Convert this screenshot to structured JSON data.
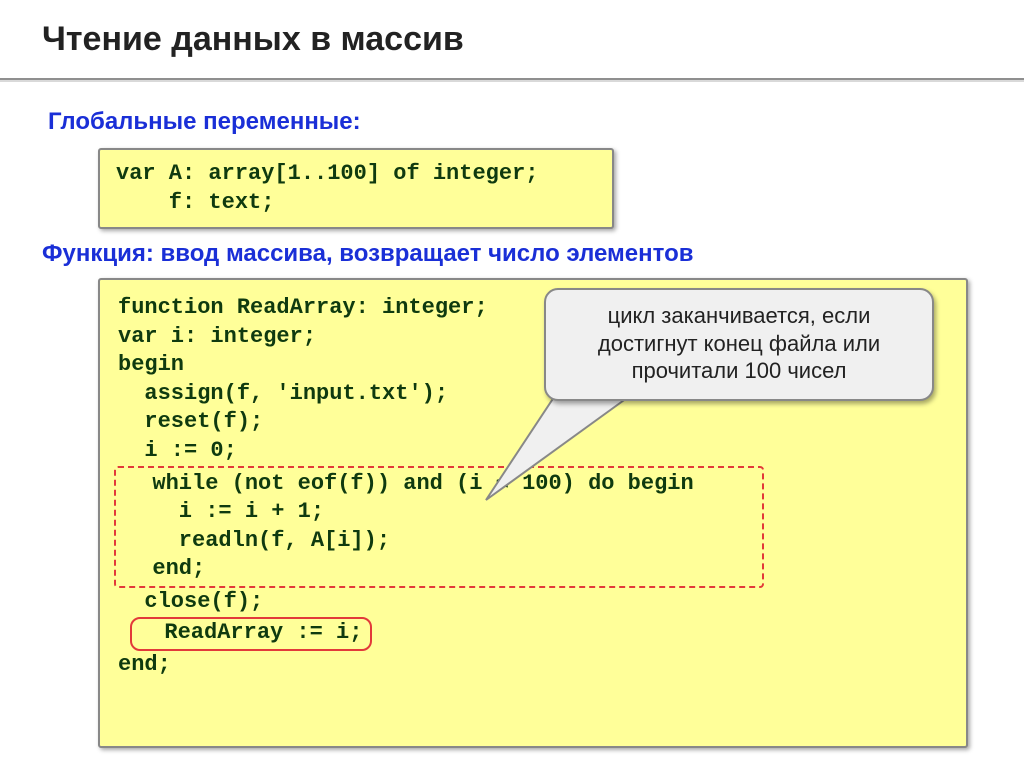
{
  "title": "Чтение данных в массив",
  "section1": "Глобальные переменные:",
  "globals_line1": "var A: array[1..100] of integer;",
  "globals_line2": "    f: text;",
  "section2": "Функция: ввод массива, возвращает число элементов",
  "callout": "цикл заканчивается, если достигнут конец файла или прочитали 100 чисел",
  "code": {
    "l1": "function ReadArray: integer;",
    "l2": "var i: integer;",
    "l3": "begin",
    "l4": "  assign(f, 'input.txt');",
    "l5": "  reset(f);",
    "l6": "  i := 0;",
    "l7": "  while (not eof(f)) and (i < 100) do begin",
    "l8": "    i := i + 1;",
    "l9": "    readln(f, A[i]);",
    "l10": "  end;",
    "l11": "  close(f);",
    "l12": "  ReadArray := i;",
    "l13": "end;"
  }
}
